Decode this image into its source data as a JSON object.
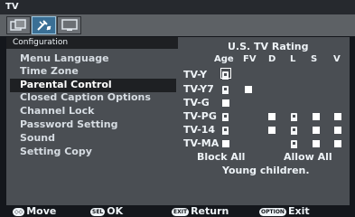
{
  "window": {
    "title": "TV"
  },
  "tabs": [
    {
      "name": "picture-tab",
      "label": ""
    },
    {
      "name": "setup-tab",
      "label": ""
    },
    {
      "name": "screen-tab",
      "label": ""
    }
  ],
  "section": {
    "title": "Configuration"
  },
  "menu": {
    "items": [
      {
        "label": "Menu Language"
      },
      {
        "label": "Time Zone"
      },
      {
        "label": "Parental Control"
      },
      {
        "label": "Closed Caption Options"
      },
      {
        "label": "Channel Lock"
      },
      {
        "label": "Password Setting"
      },
      {
        "label": "Sound"
      },
      {
        "label": "Setting Copy"
      }
    ],
    "selected_index": 2
  },
  "rating": {
    "title": "U.S. TV Rating",
    "columns": [
      "Age",
      "FV",
      "D",
      "L",
      "S",
      "V"
    ],
    "rows": [
      {
        "label": "TV-Y",
        "cells": [
          "lock",
          "",
          "",
          "",
          "",
          ""
        ]
      },
      {
        "label": "TV-Y7",
        "cells": [
          "lock",
          "block",
          "",
          "",
          "",
          ""
        ]
      },
      {
        "label": "TV-G",
        "cells": [
          "block",
          "",
          "",
          "",
          "",
          ""
        ]
      },
      {
        "label": "TV-PG",
        "cells": [
          "lock",
          "",
          "block",
          "lock",
          "block",
          "block"
        ]
      },
      {
        "label": "TV-14",
        "cells": [
          "lock",
          "",
          "block",
          "lock",
          "block",
          "block"
        ]
      },
      {
        "label": "TV-MA",
        "cells": [
          "block",
          "",
          "",
          "lock",
          "block",
          "block"
        ]
      }
    ],
    "block_all_label": "Block All",
    "allow_all_label": "Allow All",
    "description": "Young children."
  },
  "footer": {
    "move_key": "◇◇",
    "move_label": "Move",
    "ok_key": "SEL",
    "ok_label": "OK",
    "return_key": "EXIT",
    "return_label": "Return",
    "exit_key": "OPTION",
    "exit_label": "Exit"
  }
}
